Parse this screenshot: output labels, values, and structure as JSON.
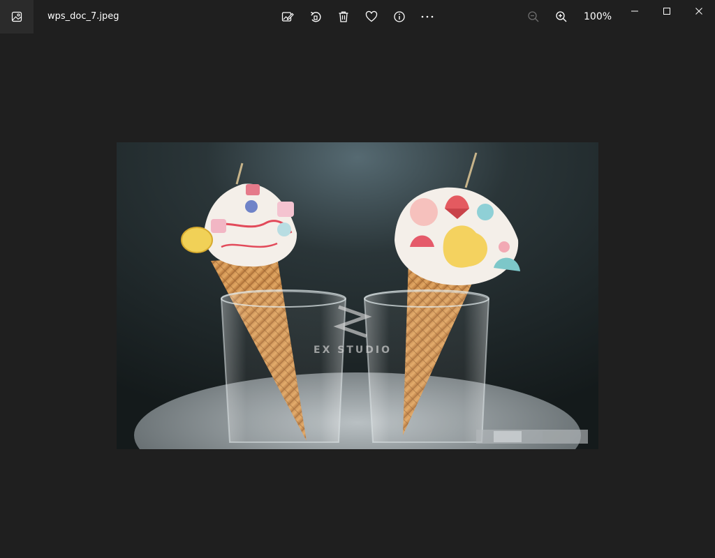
{
  "window": {
    "file_name": "wps_doc_7.jpeg",
    "zoom_level": "100%"
  },
  "toolbar": {
    "buttons": [
      {
        "name": "edit-image-button",
        "icon": "edit-image-icon"
      },
      {
        "name": "rotate-button",
        "icon": "rotate-icon"
      },
      {
        "name": "delete-button",
        "icon": "trash-icon"
      },
      {
        "name": "favorite-button",
        "icon": "heart-icon"
      },
      {
        "name": "info-button",
        "icon": "info-icon"
      },
      {
        "name": "more-button",
        "icon": "more-icon"
      }
    ]
  },
  "photo": {
    "watermark": "EX STUDIO"
  },
  "colors": {
    "background": "#1f1f1f",
    "icon_box": "#2b2b2b",
    "text": "#ffffff",
    "disabled": "#6e6e6e"
  }
}
